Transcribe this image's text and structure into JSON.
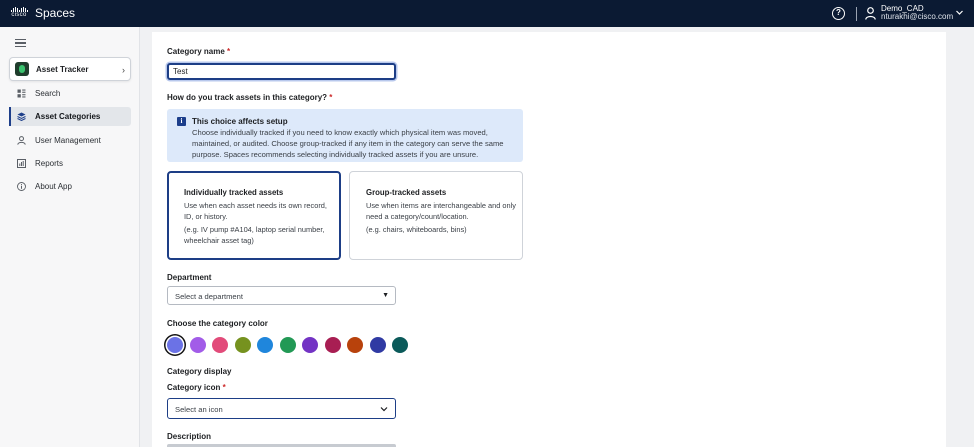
{
  "topbar": {
    "logo_text": "cisco",
    "app_name": "Spaces",
    "help_icon": "question-circle-icon",
    "user": {
      "name": "Demo_CAD",
      "email": "nturakhi@cisco.com"
    }
  },
  "sidebar": {
    "app_switcher": {
      "label": "Asset Tracker"
    },
    "items": [
      {
        "label": "Search",
        "icon": "search-icon",
        "active": false
      },
      {
        "label": "Asset Categories",
        "icon": "layers-icon",
        "active": true
      },
      {
        "label": "User Management",
        "icon": "user-icon",
        "active": false
      },
      {
        "label": "Reports",
        "icon": "report-icon",
        "active": false
      },
      {
        "label": "About App",
        "icon": "info-icon",
        "active": false
      }
    ]
  },
  "form": {
    "category_name": {
      "label": "Category name",
      "required_mark": "*",
      "value": "Test"
    },
    "tracking_question": {
      "label": "How do you track assets in this category?",
      "required_mark": "*"
    },
    "info": {
      "title": "This choice affects setup",
      "text": "Choose individually tracked if you need to know exactly which physical item was moved, maintained, or audited. Choose group-tracked if any item in the category can serve the same purpose. Spaces recommends selecting individually tracked assets if you are unsure."
    },
    "options": [
      {
        "title": "Individually tracked assets",
        "description": "Use when each asset needs its own record, ID, or history.",
        "example": "(e.g. IV pump #A104, laptop serial number, wheelchair asset tag)",
        "selected": true
      },
      {
        "title": "Group-tracked assets",
        "description": "Use when items are interchangeable and only need a category/count/location.",
        "example": "(e.g. chairs, whiteboards, bins)",
        "selected": false
      }
    ],
    "department": {
      "label": "Department",
      "placeholder": "Select a department"
    },
    "color": {
      "label": "Choose the category color",
      "selected_index": 0,
      "swatches": [
        "#6b72e6",
        "#a25ce8",
        "#e24b7a",
        "#76921f",
        "#1f86dc",
        "#229955",
        "#7333c4",
        "#a81e53",
        "#b8420c",
        "#303aa3",
        "#0b5a5a"
      ]
    },
    "display": {
      "label": "Category display"
    },
    "icon_field": {
      "label": "Category icon",
      "required_mark": "*",
      "placeholder": "Select an icon"
    },
    "description": {
      "label": "Description"
    }
  },
  "colors": {
    "topbar_bg": "#0b1a33",
    "accent": "#1d3e86",
    "info_bg": "#dde9fa",
    "required": "#cc2a2a"
  }
}
